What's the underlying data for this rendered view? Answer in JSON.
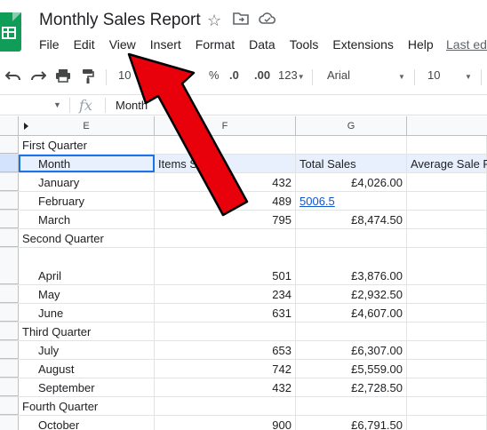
{
  "app": {
    "document_title": "Monthly Sales Report",
    "brand_color": "#0f9d58"
  },
  "menubar": {
    "items": [
      "File",
      "Edit",
      "View",
      "Insert",
      "Format",
      "Data",
      "Tools",
      "Extensions",
      "Help"
    ],
    "last_edit": "Last ed"
  },
  "toolbar": {
    "zoom": "10",
    "currency": "£",
    "percent": "%",
    "decrease_decimal": ".0",
    "increase_decimal": ".00",
    "more_formats": "123",
    "font": "Arial",
    "font_size": "10"
  },
  "formula_bar": {
    "fx_label": "fx",
    "value": "Month"
  },
  "columns": [
    "E",
    "F",
    "G"
  ],
  "rows": [
    {
      "e": "First Quarter",
      "f": "",
      "g": "",
      "h": ""
    },
    {
      "e": "Month",
      "f": "Items Sold",
      "g": "Total Sales",
      "h": "Average Sale P"
    },
    {
      "e": "January",
      "f": "432",
      "g": "£4,026.00",
      "h": ""
    },
    {
      "e": "February",
      "f": "489",
      "g": "5006.5",
      "h": ""
    },
    {
      "e": "March",
      "f": "795",
      "g": "£8,474.50",
      "h": ""
    },
    {
      "e": "Second Quarter",
      "f": "",
      "g": "",
      "h": ""
    },
    {
      "e": "April",
      "f": "501",
      "g": "£3,876.00",
      "h": ""
    },
    {
      "e": "May",
      "f": "234",
      "g": "£2,932.50",
      "h": ""
    },
    {
      "e": "June",
      "f": "631",
      "g": "£4,607.00",
      "h": ""
    },
    {
      "e": "Third Quarter",
      "f": "",
      "g": "",
      "h": ""
    },
    {
      "e": "July",
      "f": "653",
      "g": "£6,307.00",
      "h": ""
    },
    {
      "e": "August",
      "f": "742",
      "g": "£5,559.00",
      "h": ""
    },
    {
      "e": "September",
      "f": "432",
      "g": "£2,728.50",
      "h": ""
    },
    {
      "e": "Fourth Quarter",
      "f": "",
      "g": "",
      "h": ""
    },
    {
      "e": "October",
      "f": "900",
      "g": "£6,791.50",
      "h": ""
    }
  ],
  "annotation": {
    "arrow_color": "#e8000b"
  }
}
